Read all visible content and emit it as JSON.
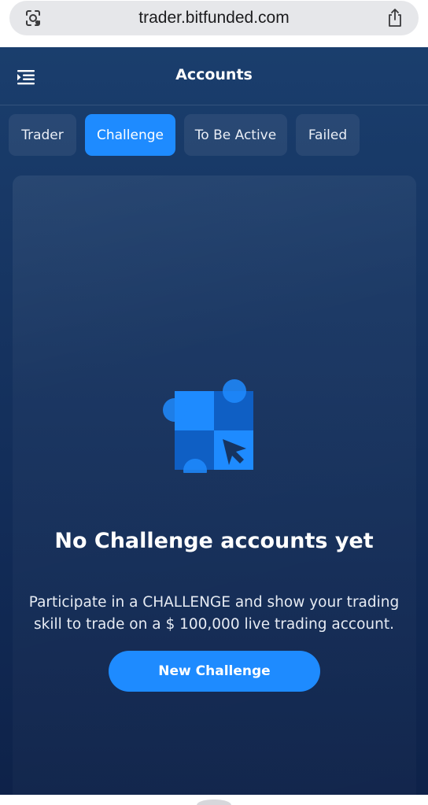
{
  "browser": {
    "url": "trader.bitfunded.com",
    "icons": [
      "lens-icon",
      "share-icon"
    ]
  },
  "header": {
    "title": "Accounts",
    "icon": "menu-icon"
  },
  "tabs": [
    {
      "label": "Trader",
      "active": false
    },
    {
      "label": "Challenge",
      "active": true
    },
    {
      "label": "To Be Active",
      "active": false
    },
    {
      "label": "Failed",
      "active": false
    }
  ],
  "empty_state": {
    "icon": "challenge-puzzle-icon",
    "title": "No Challenge accounts yet",
    "description": "Participate in a CHALLENGE and show your trading skill to trade on a $ 100,000 live trading account.",
    "button_label": "New Challenge"
  },
  "colors": {
    "accent": "#1e8bff",
    "background_top": "#1a3e6d",
    "background_bottom": "#0e2249"
  }
}
